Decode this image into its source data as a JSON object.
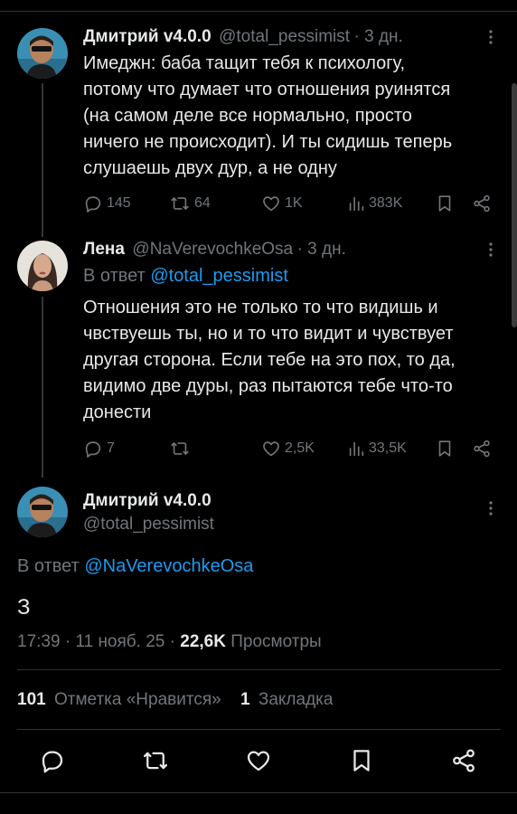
{
  "tweet1": {
    "name": "Дмитрий v4.0.0",
    "handle": "@total_pessimist",
    "time": "· 3 дн.",
    "text_lines": [
      "Имеджн: баба тащит тебя к психологу,",
      "потому что думает что отношения руинятся",
      "(на самом деле все нормально, просто",
      "ничего не происходит). И ты сидишь теперь",
      "слушаешь двух дур, а не одну"
    ],
    "replies": "145",
    "reposts": "64",
    "likes": "1K",
    "views": "383K"
  },
  "tweet2": {
    "name": "Лена",
    "handle": "@NaVerevochkeOsa",
    "time": "· 3 дн.",
    "reply_prefix": "В ответ",
    "reply_to": "@total_pessimist",
    "text_lines": [
      "Отношения это не только то что видишь и",
      "чвствуешь ты, но и то что видит и чувствует",
      "другая сторона. Если тебе на это пох, то да,",
      "видимо две дуры, раз пытаются тебе что-то",
      "донести"
    ],
    "replies": "7",
    "likes": "2,5K",
    "views": "33,5K"
  },
  "main": {
    "name": "Дмитрий v4.0.0",
    "handle": "@total_pessimist",
    "reply_prefix": "В ответ",
    "reply_to": "@NaVerevochkeOsa",
    "text": "З",
    "time": "17:39",
    "date": "11 нояб. 25",
    "views_count": "22,6K",
    "views_label": "Просмотры",
    "likes_count": "101",
    "likes_label": "Отметка «Нравится»",
    "bookmarks_count": "1",
    "bookmarks_label": "Закладка"
  },
  "icons": {
    "reply": "reply-icon",
    "repost": "repost-icon",
    "like": "heart-icon",
    "views": "views-icon",
    "bookmark": "bookmark-icon",
    "share": "share-icon",
    "more": "more-icon"
  },
  "colors": {
    "background": "#000000",
    "text": "#e7e9ea",
    "secondary": "#71767b",
    "link": "#1d9bf0",
    "divider": "#2f3336"
  }
}
